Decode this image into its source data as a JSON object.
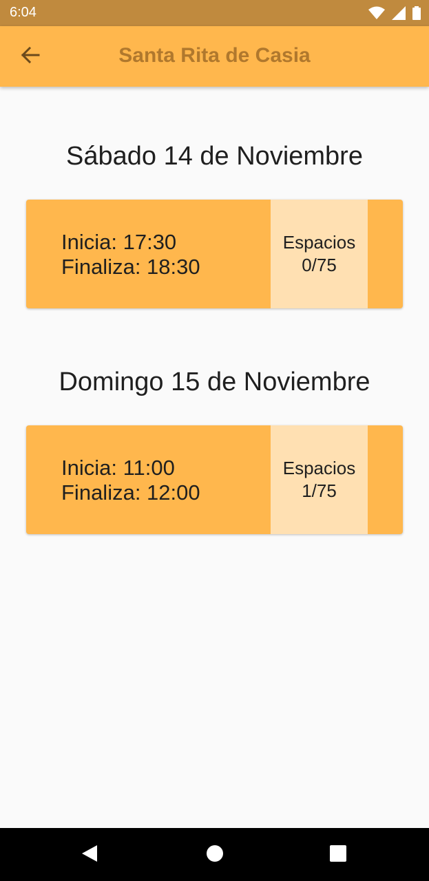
{
  "status_bar": {
    "time": "6:04",
    "icons": [
      "wifi-icon",
      "signal-icon",
      "battery-icon"
    ]
  },
  "app_bar": {
    "title": "Santa Rita de Casia",
    "back_icon": "arrow-back-icon"
  },
  "days": [
    {
      "title": "Sábado 14 de Noviembre",
      "slot": {
        "start": "Inicia: 17:30",
        "end": "Finaliza: 18:30",
        "spaces_label": "Espacios",
        "spaces_value": "0/75"
      }
    },
    {
      "title": "Domingo 15 de Noviembre",
      "slot": {
        "start": "Inicia: 11:00",
        "end": "Finaliza: 12:00",
        "spaces_label": "Espacios",
        "spaces_value": "1/75"
      }
    }
  ],
  "nav_bar": {
    "icons": [
      "nav-back-icon",
      "nav-home-icon",
      "nav-recents-icon"
    ]
  },
  "colors": {
    "status_bar": "#c08a3e",
    "app_bar": "#ffb74d",
    "title_text": "#b0782d",
    "card": "#ffb74d",
    "spaces_panel": "#ffe0b2",
    "background": "#fafafa"
  }
}
